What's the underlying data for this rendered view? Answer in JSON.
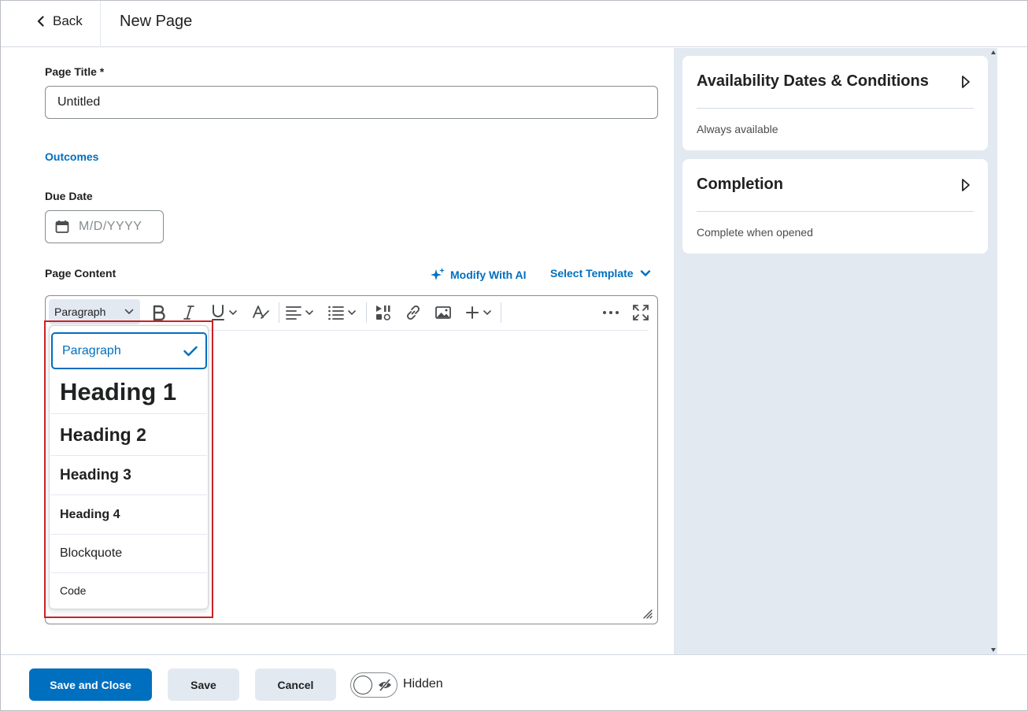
{
  "header": {
    "back_label": "Back",
    "title": "New Page"
  },
  "form": {
    "page_title_label": "Page Title *",
    "page_title_value": "Untitled",
    "outcomes_label": "Outcomes",
    "due_date_label": "Due Date",
    "due_date_placeholder": "M/D/YYYY",
    "page_content_label": "Page Content",
    "modify_ai_label": "Modify With AI",
    "select_template_label": "Select Template"
  },
  "toolbar": {
    "format_value": "Paragraph",
    "icons": [
      "bold-icon",
      "italic-icon",
      "underline-icon",
      "text-style-icon",
      "align-icon",
      "list-icon",
      "media-icon",
      "link-icon",
      "image-icon",
      "insert-icon",
      "more-icon",
      "fullscreen-icon"
    ]
  },
  "format_dropdown": {
    "items": [
      {
        "label": "Paragraph",
        "selected": true
      },
      {
        "label": "Heading 1"
      },
      {
        "label": "Heading 2"
      },
      {
        "label": "Heading 3"
      },
      {
        "label": "Heading 4"
      },
      {
        "label": "Blockquote"
      },
      {
        "label": "Code"
      }
    ]
  },
  "sidebar": {
    "cards": [
      {
        "title": "Availability Dates & Conditions",
        "subtitle": "Always available"
      },
      {
        "title": "Completion",
        "subtitle": "Complete when opened"
      }
    ]
  },
  "footer": {
    "save_close_label": "Save and Close",
    "save_label": "Save",
    "cancel_label": "Cancel",
    "visibility_label": "Hidden"
  },
  "colors": {
    "accent": "#006fbf",
    "panel_bg": "#e3e9f1",
    "highlight": "#cd2026"
  }
}
